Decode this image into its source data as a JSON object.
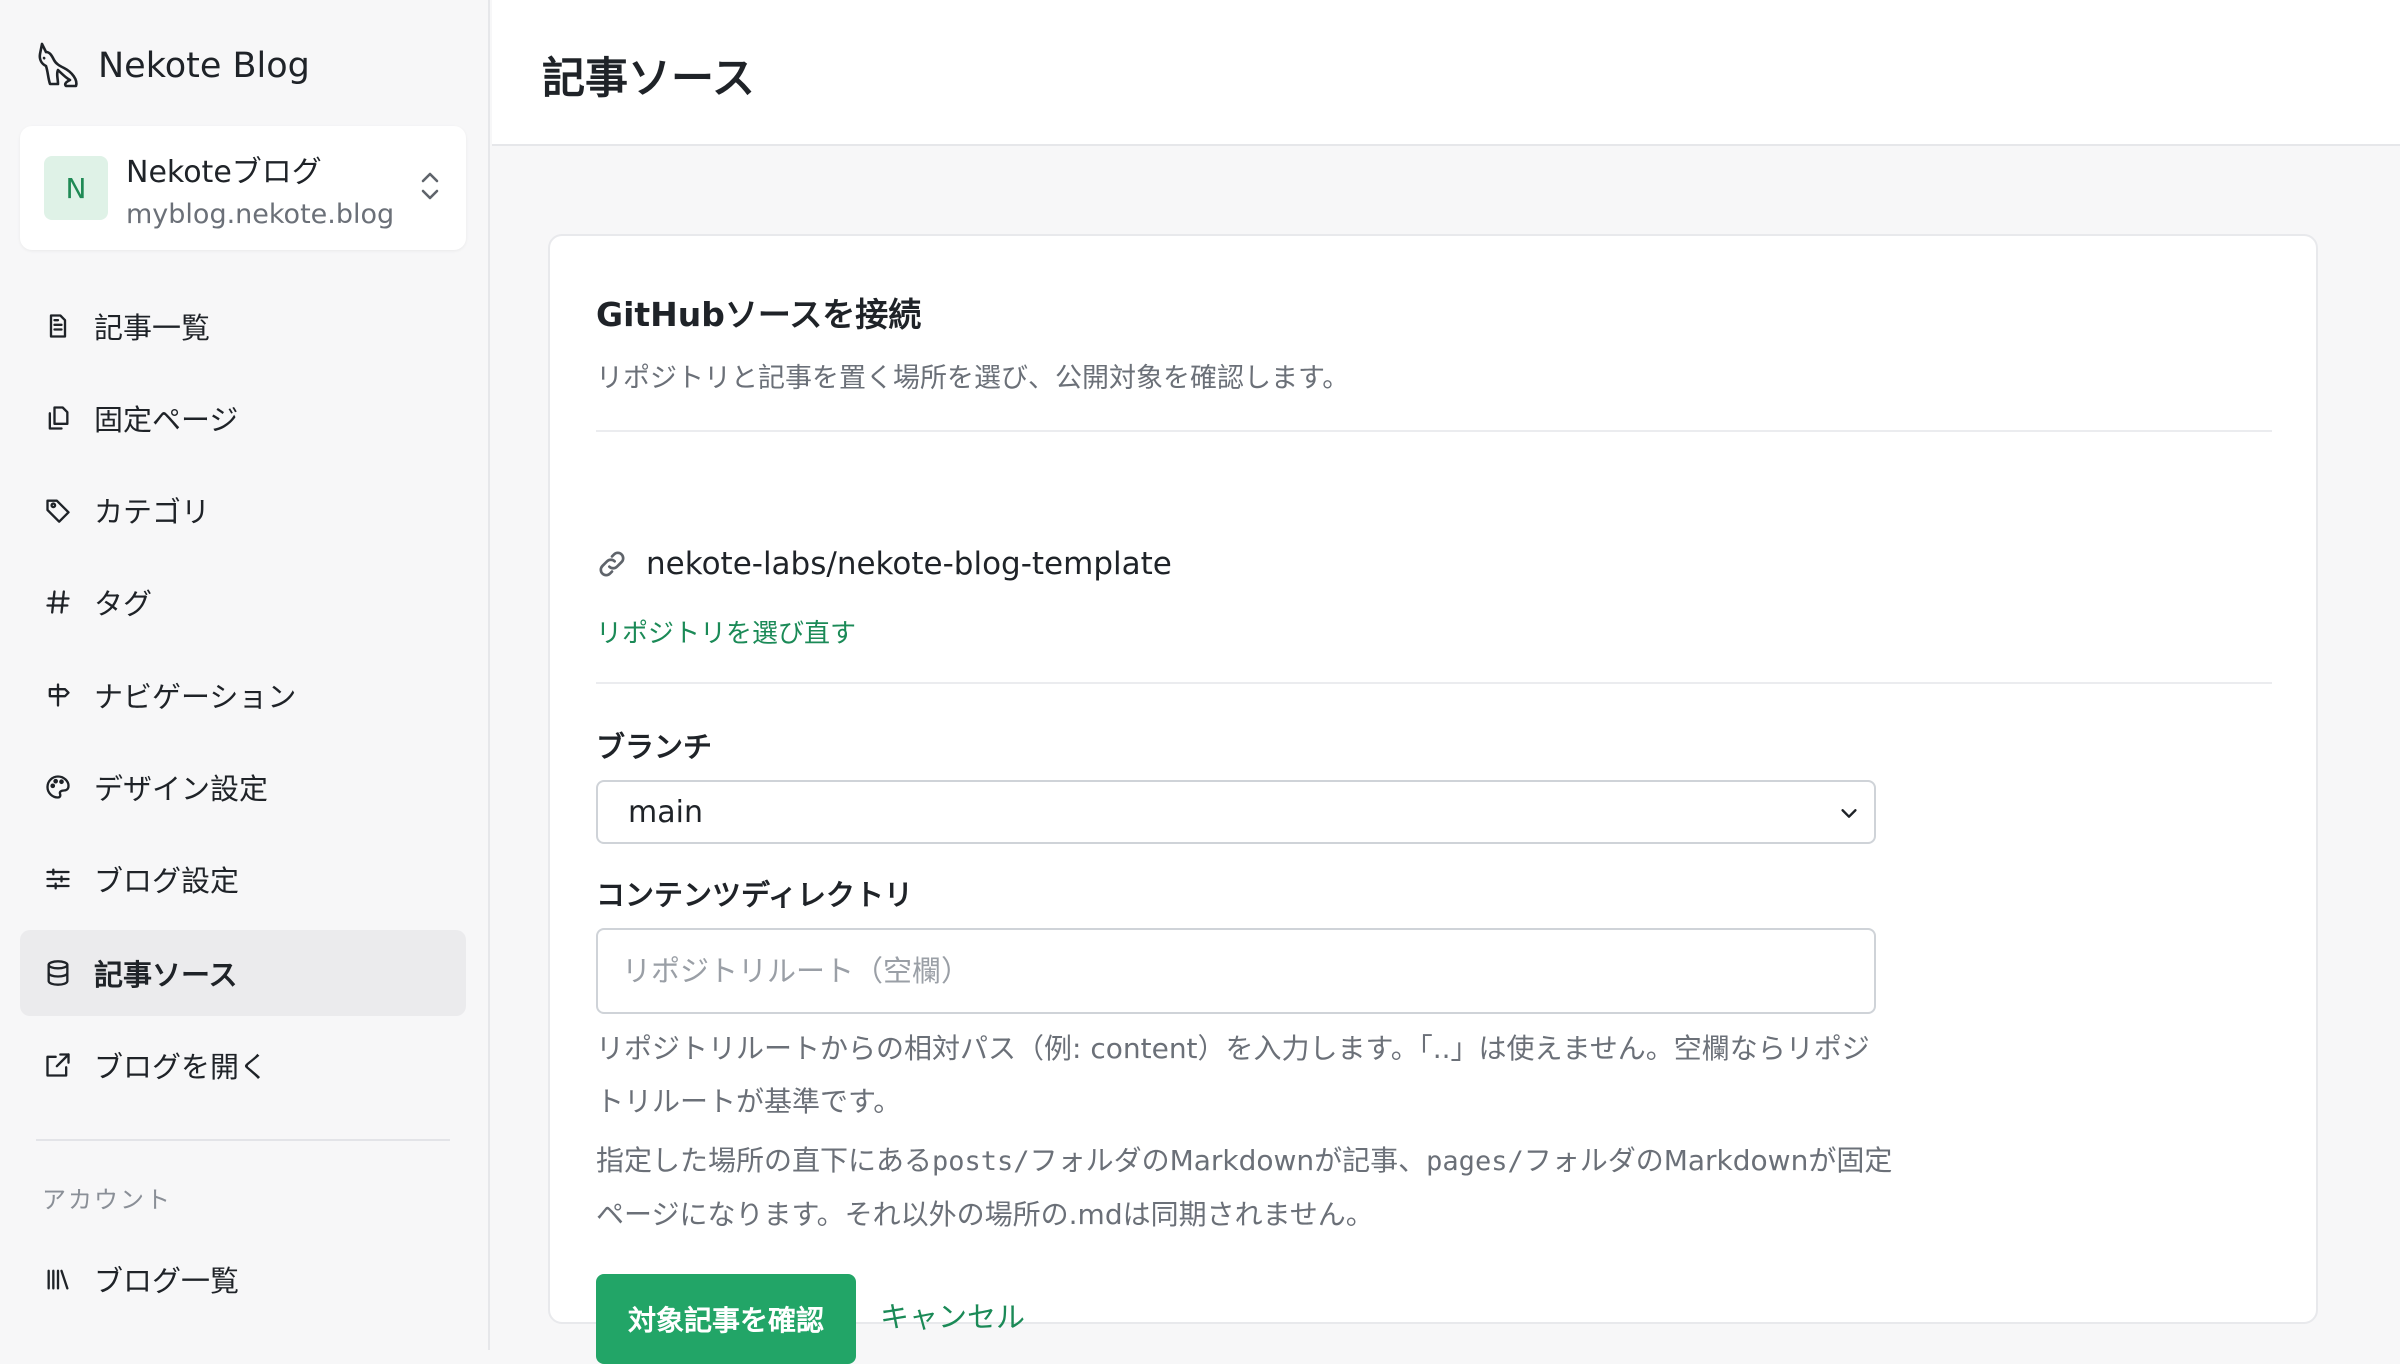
{
  "app": {
    "name": "Nekote Blog"
  },
  "blog_switcher": {
    "avatar_letter": "N",
    "name": "Nekoteブログ",
    "url": "myblog.nekote.blog"
  },
  "sidebar": {
    "items": [
      {
        "label": "記事一覧",
        "icon": "document-icon"
      },
      {
        "label": "固定ページ",
        "icon": "copy-icon"
      },
      {
        "label": "カテゴリ",
        "icon": "tag-icon"
      },
      {
        "label": "タグ",
        "icon": "hash-icon"
      },
      {
        "label": "ナビゲーション",
        "icon": "signpost-icon"
      },
      {
        "label": "デザイン設定",
        "icon": "palette-icon"
      },
      {
        "label": "ブログ設定",
        "icon": "sliders-icon"
      },
      {
        "label": "記事ソース",
        "icon": "database-icon",
        "active": true
      },
      {
        "label": "ブログを開く",
        "icon": "external-link-icon"
      }
    ],
    "account_label": "アカウント",
    "account_items": [
      {
        "label": "ブログ一覧",
        "icon": "library-icon"
      }
    ]
  },
  "page": {
    "title": "記事ソース"
  },
  "card": {
    "title": "GitHubソースを接続",
    "description": "リポジトリと記事を置く場所を選び、公開対象を確認します。",
    "repo_name": "nekote-labs/nekote-blog-template",
    "reselect_link": "リポジトリを選び直す",
    "branch_label": "ブランチ",
    "branch_value": "main",
    "dir_label": "コンテンツディレクトリ",
    "dir_placeholder": "リポジトリルート（空欄）",
    "help1": "リポジトリルートからの相対パス（例: content）を入力します。「..」は使えません。空欄ならリポジトリルートが基準です。",
    "help2_a": "指定した場所の直下にある",
    "help2_code1": "posts/",
    "help2_b": "フォルダのMarkdownが記事、",
    "help2_code2": "pages/",
    "help2_c": "フォルダのMarkdownが固定ページになります。それ以外の場所の.mdは同期されません。",
    "confirm_button": "対象記事を確認",
    "cancel_button": "キャンセル"
  },
  "colors": {
    "accent": "#22a567",
    "link": "#1b8a57",
    "active_bg": "#ebebed"
  }
}
